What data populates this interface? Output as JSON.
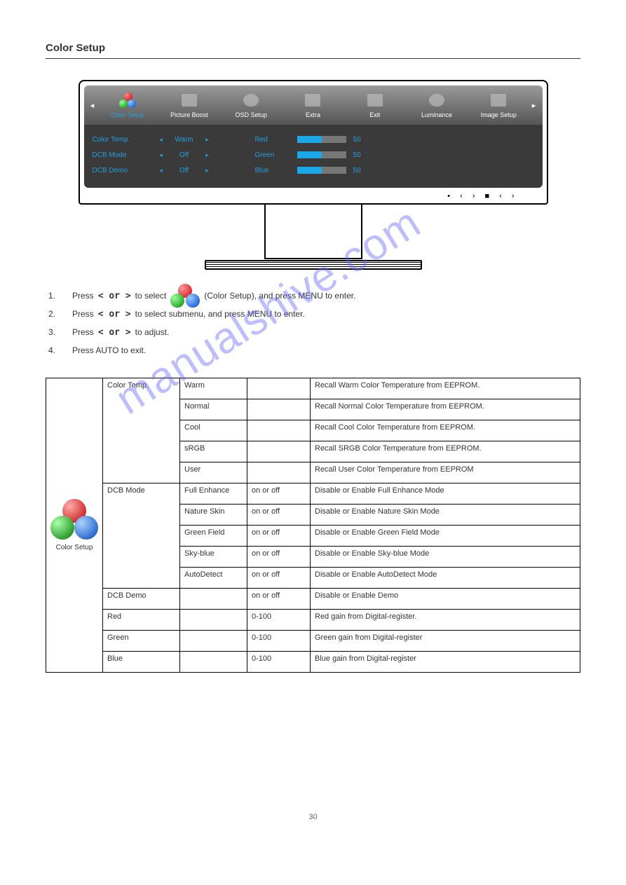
{
  "section_title": "Color Setup",
  "osd": {
    "tabs": [
      "Color Setup",
      "Picture Boost",
      "OSD Setup",
      "Extra",
      "Exit",
      "Luminance",
      "Image Setup"
    ],
    "rows": [
      {
        "label": "Color Temp.",
        "value": "Warm",
        "rgb_label": "Red",
        "rgb_value": "50"
      },
      {
        "label": "DCB Mode",
        "value": "Off",
        "rgb_label": "Green",
        "rgb_value": "50"
      },
      {
        "label": "DCB Demo",
        "value": "Off",
        "rgb_label": "Blue",
        "rgb_value": "50"
      }
    ]
  },
  "instructions": [
    {
      "n": "1.",
      "pre": "Press",
      "keys": "<  or  >",
      "post": "to select",
      "icon": true,
      "tail": "(Color Setup), and press MENU to enter."
    },
    {
      "n": "2.",
      "pre": "Press",
      "keys": "<  or  >",
      "post": "to select submenu, and press MENU to enter.",
      "icon": false,
      "tail": ""
    },
    {
      "n": "3.",
      "pre": "Press",
      "keys": "<  or  >",
      "post": "to adjust.",
      "icon": false,
      "tail": ""
    },
    {
      "n": "4.",
      "pre": "Press AUTO to exit.",
      "keys": "",
      "post": "",
      "icon": false,
      "tail": ""
    }
  ],
  "table": {
    "icon_label": "Color Setup",
    "groups": [
      {
        "name": "Color Temp.",
        "rows": [
          {
            "opt": "Warm",
            "val": "",
            "desc": "Recall Warm Color Temperature from EEPROM."
          },
          {
            "opt": "Normal",
            "val": "",
            "desc": "Recall Normal Color Temperature from EEPROM."
          },
          {
            "opt": "Cool",
            "val": "",
            "desc": "Recall Cool Color Temperature from EEPROM."
          },
          {
            "opt": "sRGB",
            "val": "",
            "desc": "Recall SRGB Color Temperature from EEPROM."
          },
          {
            "opt": "User",
            "val": "",
            "desc": "Recall User Color Temperature from EEPROM"
          }
        ]
      },
      {
        "name": "DCB Mode",
        "rows": [
          {
            "opt": "Full Enhance",
            "val": "on or off",
            "desc": "Disable or Enable Full Enhance Mode"
          },
          {
            "opt": "Nature Skin",
            "val": "on or off",
            "desc": "Disable or Enable Nature Skin Mode"
          },
          {
            "opt": "Green Field",
            "val": "on or off",
            "desc": "Disable or Enable Green Field Mode"
          },
          {
            "opt": "Sky-blue",
            "val": "on or off",
            "desc": "Disable or Enable Sky-blue Mode"
          },
          {
            "opt": "AutoDetect",
            "val": "on or off",
            "desc": "Disable or Enable AutoDetect Mode"
          }
        ]
      },
      {
        "name": "DCB Demo",
        "single": {
          "opt": "",
          "val": "on or off",
          "desc": "Disable or Enable Demo"
        }
      },
      {
        "name": "Red",
        "single": {
          "opt": "",
          "val": "0-100",
          "desc": "Red gain from Digital-register."
        }
      },
      {
        "name": "Green",
        "single": {
          "opt": "",
          "val": "0-100",
          "desc": "Green gain  from Digital-register"
        }
      },
      {
        "name": "Blue",
        "single": {
          "opt": "",
          "val": "0-100",
          "desc": "Blue gain  from Digital-register"
        }
      }
    ]
  },
  "watermark": "manualshive.com",
  "page_number": "30"
}
